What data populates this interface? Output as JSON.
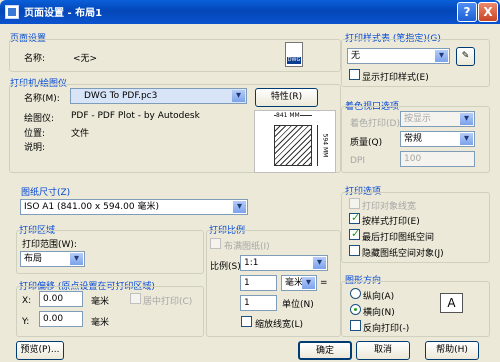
{
  "window": {
    "title": "页面设置 - 布局1",
    "help": "?",
    "close": "X"
  },
  "page_setup": {
    "title": "页面设置",
    "name_label": "名称:",
    "name_value": "<无>",
    "icon": "dwg-file-icon"
  },
  "printer": {
    "title": "打印机/绘图仪",
    "name_label": "名称(M):",
    "name_value": "DWG To PDF.pc3",
    "properties": "特性(R)",
    "plotter_label": "绘图仪:",
    "plotter_value": "PDF - PDF Plot - by Autodesk",
    "location_label": "位置:",
    "location_value": "文件",
    "description_label": "说明:",
    "preview_width": "841 MM",
    "preview_height": "594 MM"
  },
  "paper": {
    "title": "图纸尺寸(Z)",
    "value": "ISO A1 (841.00 x 594.00 毫米)"
  },
  "plot_area": {
    "title": "打印区域",
    "label": "打印范围(W):",
    "value": "布局"
  },
  "plot_scale": {
    "title": "打印比例",
    "fit_label": "布满图纸(I)",
    "scale_label": "比例(S):",
    "scale_value": "1:1",
    "value1": "1",
    "unit1": "毫米",
    "equals": "=",
    "value2": "1",
    "unit2": "单位(N)",
    "lineweights": "缩放线宽(L)"
  },
  "plot_offset": {
    "title": "打印偏移 (原点设置在可打印区域)",
    "x_label": "X:",
    "x_value": "0.00",
    "x_unit": "毫米",
    "center": "居中打印(C)",
    "y_label": "Y:",
    "y_value": "0.00",
    "y_unit": "毫米"
  },
  "plot_style": {
    "title": "打印样式表 (笔指定)(G)",
    "value": "无",
    "show": "显示打印样式(E)"
  },
  "viewport": {
    "title": "着色视口选项",
    "shade_label": "着色打印(D)",
    "shade_value": "按显示",
    "quality_label": "质量(Q)",
    "quality_value": "常规",
    "dpi_label": "DPI",
    "dpi_value": "100"
  },
  "plot_options": {
    "title": "打印选项",
    "opt1": "打印对象线宽",
    "opt2": "按样式打印(E)",
    "opt3": "最后打印图纸空间",
    "opt4": "隐藏图纸空间对象(J)"
  },
  "orientation": {
    "title": "图形方向",
    "portrait": "纵向(A)",
    "landscape": "横向(N)",
    "upside": "反向打印(-)",
    "icon_letter": "A"
  },
  "buttons": {
    "preview": "预览(P)...",
    "ok": "确定",
    "cancel": "取消",
    "help": "帮助(H)"
  }
}
